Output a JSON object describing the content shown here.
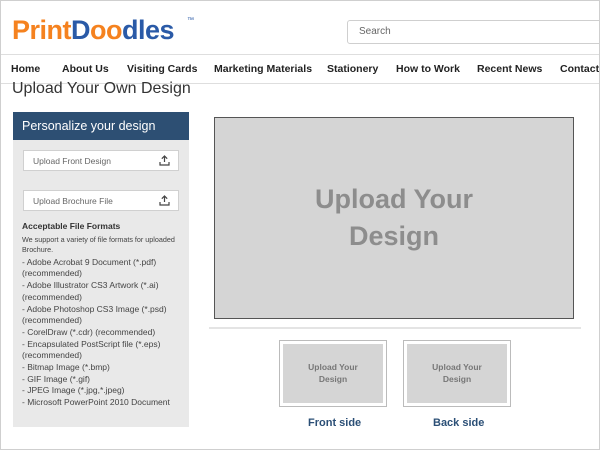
{
  "brand": {
    "part1": "Print",
    "part2": "D",
    "part3": "oo",
    "part4": "dles",
    "tm": "™"
  },
  "search": {
    "placeholder": "Search"
  },
  "nav": [
    "Home",
    "About Us",
    "Visiting Cards",
    "Marketing Materials",
    "Stationery",
    "How to Work",
    "Recent News",
    "Contact"
  ],
  "page_title": "Upload Your Own Design",
  "panel": {
    "heading": "Personalize your design",
    "upload_front": "Upload Front Design",
    "upload_brochure": "Upload Brochure File",
    "formats_heading": "Acceptable File Formats",
    "formats_intro": "We support a variety of file formats for uploaded Brochure.",
    "formats": [
      "- Adobe Acrobat 9 Document (*.pdf) (recommended)",
      "- Adobe Illustrator CS3 Artwork (*.ai) (recommended)",
      "- Adobe Photoshop CS3 Image (*.psd) (recommended)",
      "- CorelDraw (*.cdr) (recommended)",
      "- Encapsulated PostScript file (*.eps) (recommended)",
      "- Bitmap Image (*.bmp)",
      "- GIF Image (*.gif)",
      "- JPEG Image (*.jpg,*.jpeg)",
      "- Microsoft PowerPoint 2010 Document"
    ]
  },
  "preview": {
    "text": "Upload Your Design"
  },
  "thumbs": [
    {
      "text": "Upload Your Design",
      "label": "Front side"
    },
    {
      "text": "Upload Your Design",
      "label": "Back side"
    }
  ]
}
